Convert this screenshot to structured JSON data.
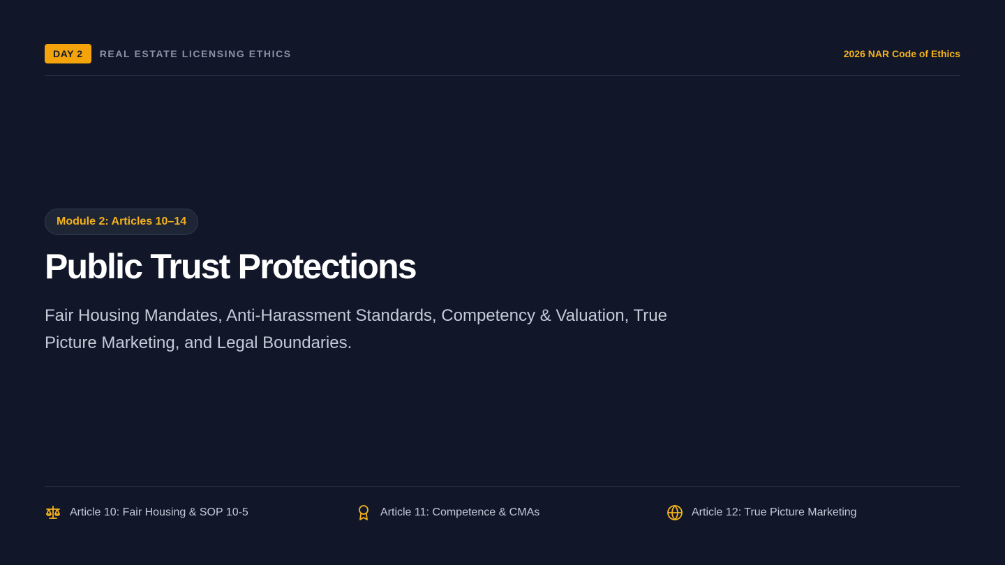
{
  "header": {
    "day_badge": "DAY 2",
    "course_label": "REAL ESTATE LICENSING ETHICS",
    "edition": "2026 NAR Code of Ethics"
  },
  "main": {
    "module_pill": "Module 2: Articles 10–14",
    "title": "Public Trust Protections",
    "subtitle": "Fair Housing Mandates, Anti-Harassment Standards, Competency & Valuation, True Picture Marketing, and Legal Boundaries."
  },
  "footer": {
    "items": [
      {
        "icon": "scale-icon",
        "label": "Article 10: Fair Housing & SOP 10-5"
      },
      {
        "icon": "award-ribbon-icon",
        "label": "Article 11: Competence & CMAs"
      },
      {
        "icon": "globe-icon",
        "label": "Article 12: True Picture Marketing"
      }
    ]
  },
  "colors": {
    "background": "#111729",
    "accent": "#f5a30a",
    "accent_text": "#f5b21d",
    "title": "#ffffff",
    "body_text": "#c4cad6",
    "muted_text": "#8b93a6"
  }
}
